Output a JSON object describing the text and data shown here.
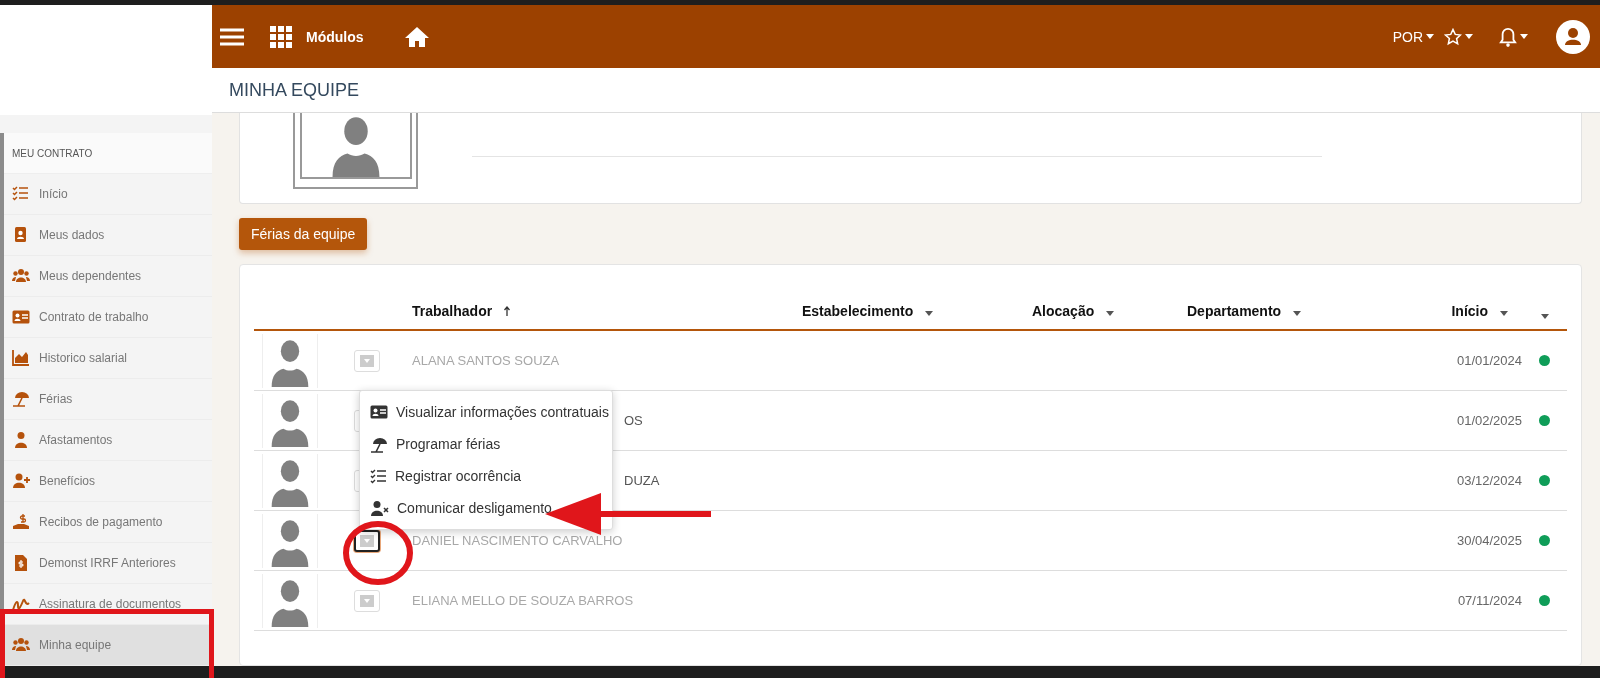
{
  "topbar": {
    "modules_label": "Módulos",
    "language": "POR"
  },
  "page_title": "MINHA EQUIPE",
  "sidebar": {
    "section": "MEU CONTRATO",
    "items": [
      {
        "label": "Início",
        "selected": false
      },
      {
        "label": "Meus dados",
        "selected": false
      },
      {
        "label": "Meus dependentes",
        "selected": false
      },
      {
        "label": "Contrato de trabalho",
        "selected": false
      },
      {
        "label": "Historico salarial",
        "selected": false
      },
      {
        "label": "Férias",
        "selected": false
      },
      {
        "label": "Afastamentos",
        "selected": false
      },
      {
        "label": "Benefícios",
        "selected": false
      },
      {
        "label": "Recibos de pagamento",
        "selected": false
      },
      {
        "label": "Demonst IRRF Anteriores",
        "selected": false
      },
      {
        "label": "Assinatura de documentos",
        "selected": false
      },
      {
        "label": "Minha equipe",
        "selected": true
      }
    ]
  },
  "team_vacation_button": "Férias da equipe",
  "table": {
    "columns": [
      {
        "label": "Trabalhador",
        "sorted": true
      },
      {
        "label": "Estabelecimento",
        "sorted": false
      },
      {
        "label": "Alocação",
        "sorted": false
      },
      {
        "label": "Departamento",
        "sorted": false
      },
      {
        "label": "Início",
        "sorted": false
      }
    ],
    "rows": [
      {
        "name": "ALANA SANTOS SOUZA",
        "covered": false,
        "start": "01/01/2024",
        "color": "#0f9d58",
        "focused": false
      },
      {
        "name": "OS",
        "covered": true,
        "start": "01/02/2025",
        "color": "#0f9d58",
        "focused": false
      },
      {
        "name": "DUZA",
        "covered": true,
        "start": "03/12/2024",
        "color": "#0f9d58",
        "focused": false
      },
      {
        "name": "DANIEL NASCIMENTO CARVALHO",
        "covered": false,
        "start": "30/04/2025",
        "color": "#0f9d58",
        "focused": true
      },
      {
        "name": "ELIANA MELLO DE SOUZA BARROS",
        "covered": false,
        "start": "07/11/2024",
        "color": "#0f9d58",
        "focused": false
      }
    ]
  },
  "context_menu": {
    "items": [
      {
        "label": "Visualizar informações contratuais"
      },
      {
        "label": "Programar férias"
      },
      {
        "label": "Registrar ocorrência"
      },
      {
        "label": "Comunicar desligamento"
      }
    ]
  }
}
